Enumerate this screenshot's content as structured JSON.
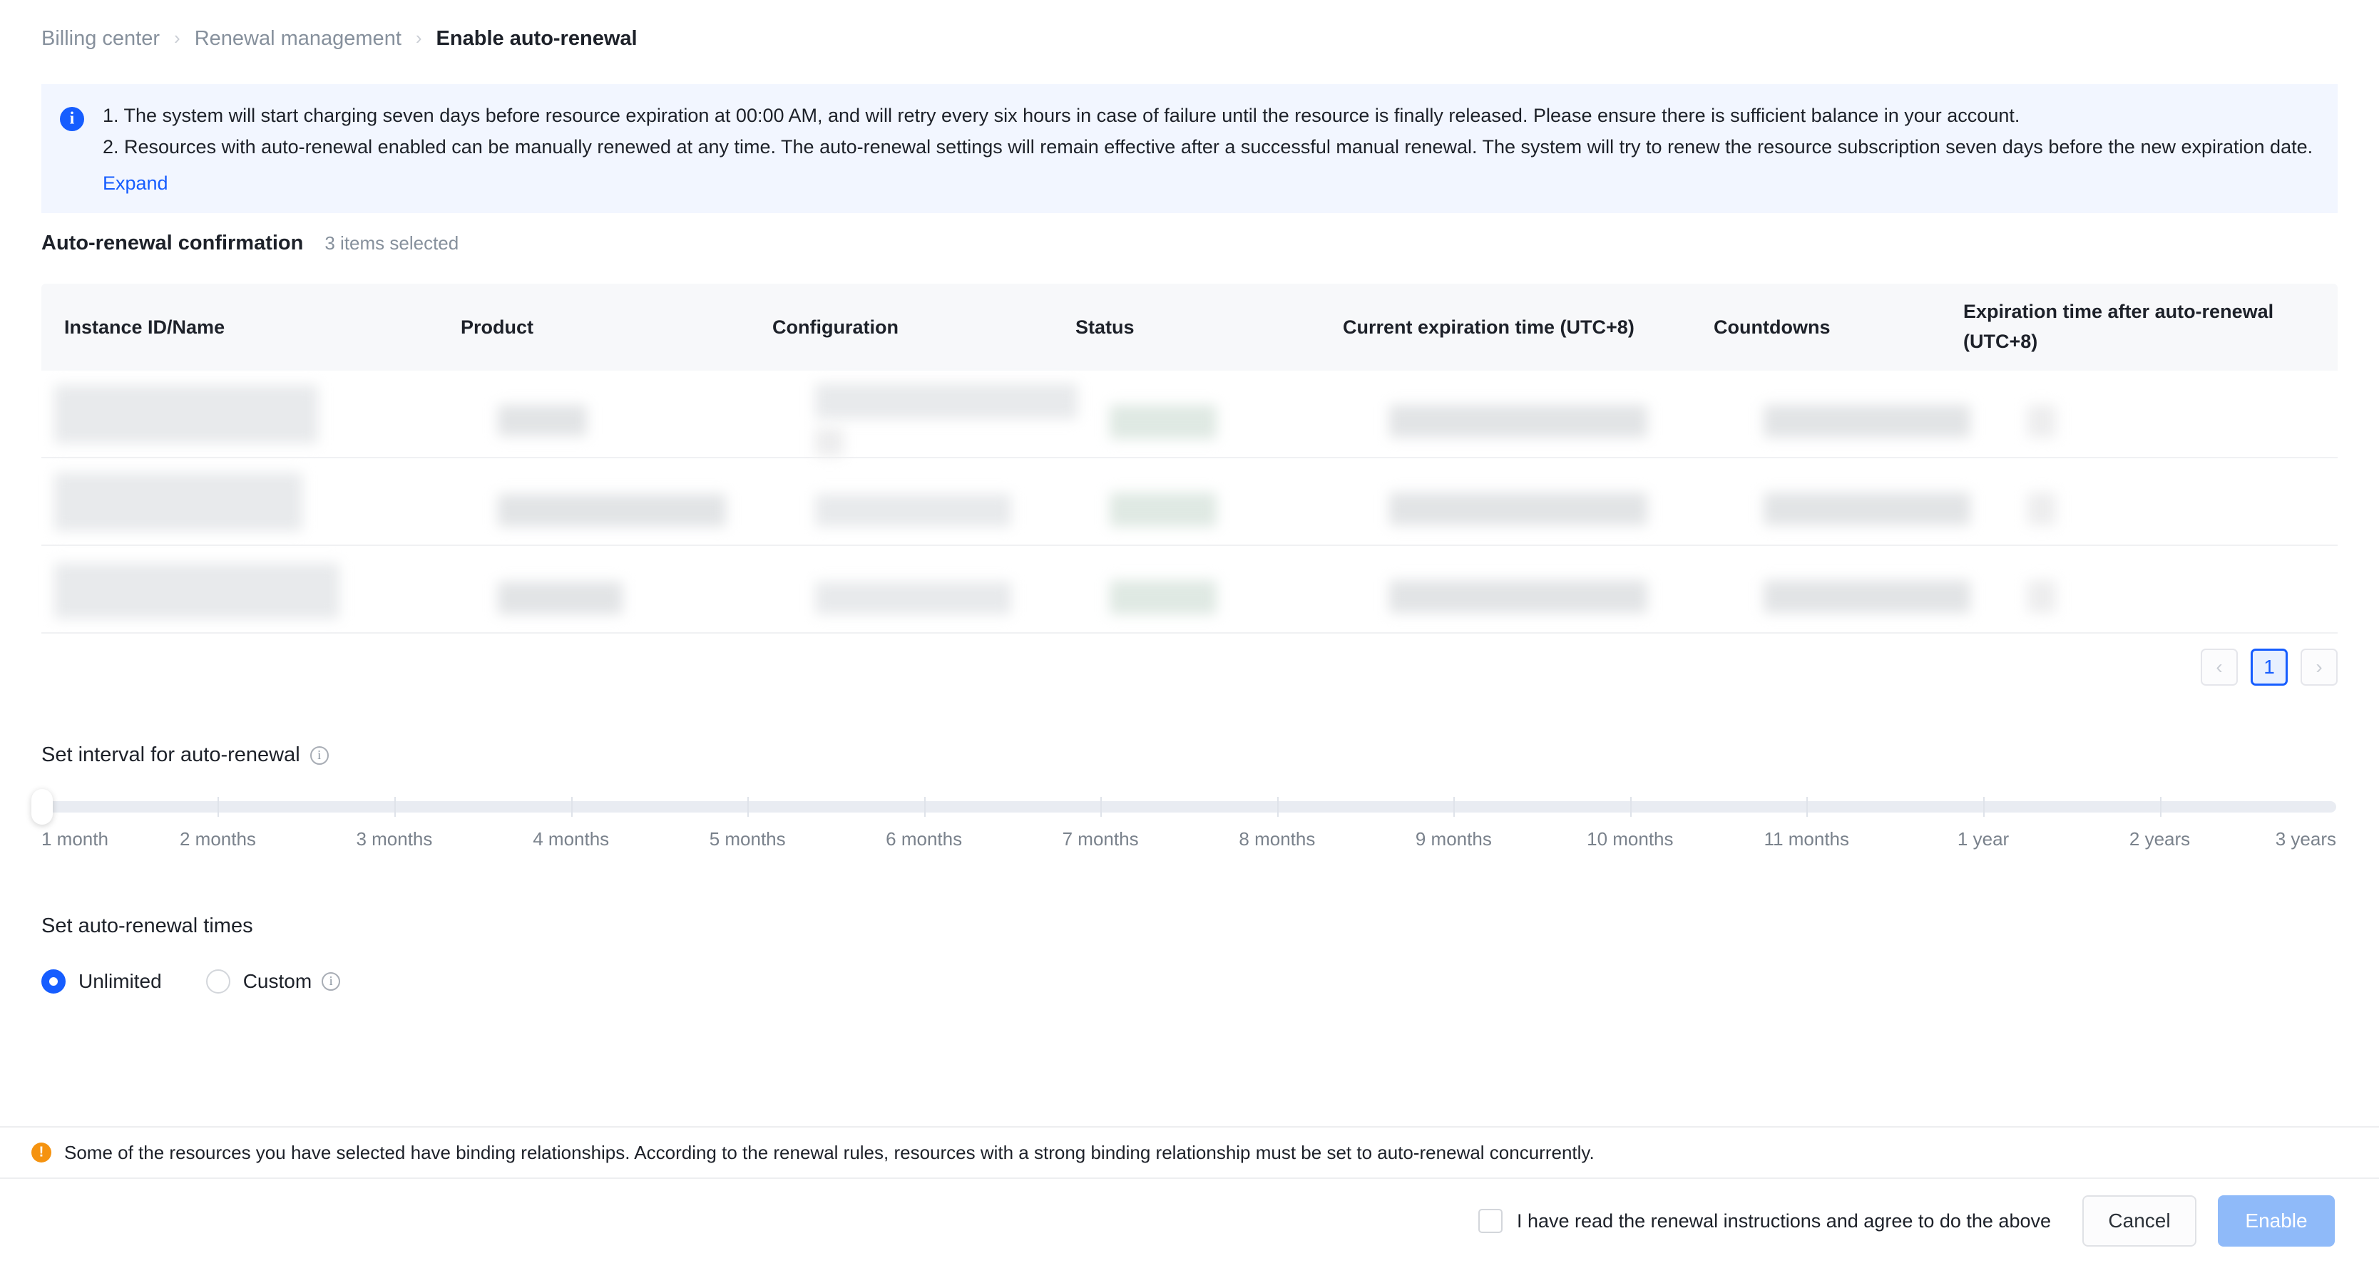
{
  "breadcrumb": {
    "items": [
      {
        "label": "Billing center",
        "current": false
      },
      {
        "label": "Renewal management",
        "current": false
      },
      {
        "label": "Enable auto-renewal",
        "current": true
      }
    ],
    "separator": "›"
  },
  "banner": {
    "icon": "info-circle-icon",
    "lines": [
      "1. The system will start charging seven days before resource expiration at 00:00 AM, and will retry every six hours in case of failure until the resource is finally released. Please ensure there is sufficient balance in your account.",
      "2. Resources with auto-renewal enabled can be manually renewed at any time. The auto-renewal settings will remain effective after a successful manual renewal. The system will try to renew the resource subscription seven days before the new expiration date."
    ],
    "expand_label": "Expand",
    "accent_color": "#165dff",
    "background_color": "#f2f6ff"
  },
  "section": {
    "title": "Auto-renewal confirmation",
    "selected_count_label": "3 items selected"
  },
  "table": {
    "columns": [
      "Instance ID/Name",
      "Product",
      "Configuration",
      "Status",
      "Current expiration time (UTC+8)",
      "Countdowns",
      "Expiration time after auto-renewal (UTC+8)"
    ],
    "rows": [
      {
        "redacted": true
      },
      {
        "redacted": true
      },
      {
        "redacted": true
      }
    ],
    "header_background": "#f7f8fa",
    "status_cell_color": "#dfe9e3"
  },
  "pagination": {
    "prev_icon": "chevron-left-icon",
    "next_icon": "chevron-right-icon",
    "current_page": "1",
    "active_color": "#165dff"
  },
  "interval": {
    "title": "Set interval for auto-renewal",
    "info_icon": "info-outline-icon",
    "ticks": [
      "1 month",
      "2 months",
      "3 months",
      "4 months",
      "5 months",
      "6 months",
      "7 months",
      "8 months",
      "9 months",
      "10 months",
      "11 months",
      "1 year",
      "2 years",
      "3 years"
    ],
    "selected_index": 0,
    "track_color": "#e9ecf2"
  },
  "renewal_times": {
    "title": "Set auto-renewal times",
    "options": [
      {
        "label": "Unlimited",
        "selected": true,
        "has_info_icon": false
      },
      {
        "label": "Custom",
        "selected": false,
        "has_info_icon": true
      }
    ],
    "selected_color": "#165dff"
  },
  "warning": {
    "icon": "warning-circle-icon",
    "color": "#f59310",
    "text": "Some of the resources you have selected have binding relationships. According to the renewal rules, resources with a strong binding relationship must be set to auto-renewal concurrently."
  },
  "footer": {
    "agree_label": "I have read the renewal instructions and agree to do the above",
    "agree_checked": false,
    "cancel_label": "Cancel",
    "enable_label": "Enable",
    "enable_disabled": true,
    "enable_color": "#8fbaf9"
  }
}
